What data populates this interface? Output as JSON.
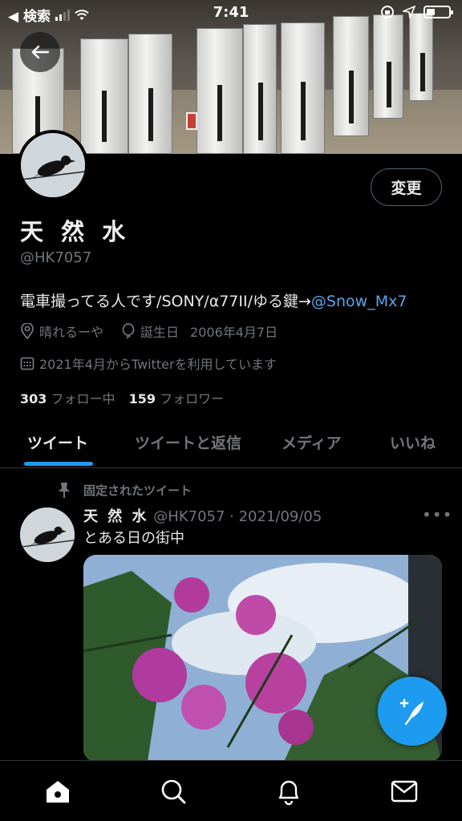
{
  "status_bar": {
    "back_app": "◀ 検索",
    "time": "7:41"
  },
  "profile": {
    "name": "天 然 水",
    "handle": "@HK7057",
    "bio_text": "電車撮ってる人です/SONY/α77II/ゆる鍵→",
    "bio_mention": "@Snow_Mx7",
    "location": "晴れるーや",
    "birthday_label": "誕生日",
    "birthday": "2006年4月7日",
    "joined": "2021年4月からTwitterを利用しています",
    "following_count": "303",
    "following_label": "フォロー中",
    "followers_count": "159",
    "followers_label": "フォロワー",
    "edit_label": "変更"
  },
  "tabs": [
    {
      "label": "ツイート",
      "active": true
    },
    {
      "label": "ツイートと返信",
      "active": false
    },
    {
      "label": "メディア",
      "active": false
    },
    {
      "label": "いいね",
      "active": false
    }
  ],
  "pinned_tweet": {
    "pinned_label": "固定されたツイート",
    "author_name": "天 然 水",
    "author_meta": "@HK7057 · 2021/09/05",
    "text": "とある日の街中",
    "more": "•••"
  },
  "colors": {
    "accent": "#1d9bf0",
    "mention": "#5aa4e8",
    "secondary_text": "#71767b",
    "background": "#000000"
  },
  "icons": {
    "back": "arrow-left-icon",
    "location": "location-pin-icon",
    "birthday": "balloon-icon",
    "calendar": "calendar-icon",
    "pin": "pin-icon",
    "compose": "compose-feather-icon",
    "nav": [
      "home-icon",
      "search-icon",
      "bell-icon",
      "mail-icon"
    ]
  }
}
